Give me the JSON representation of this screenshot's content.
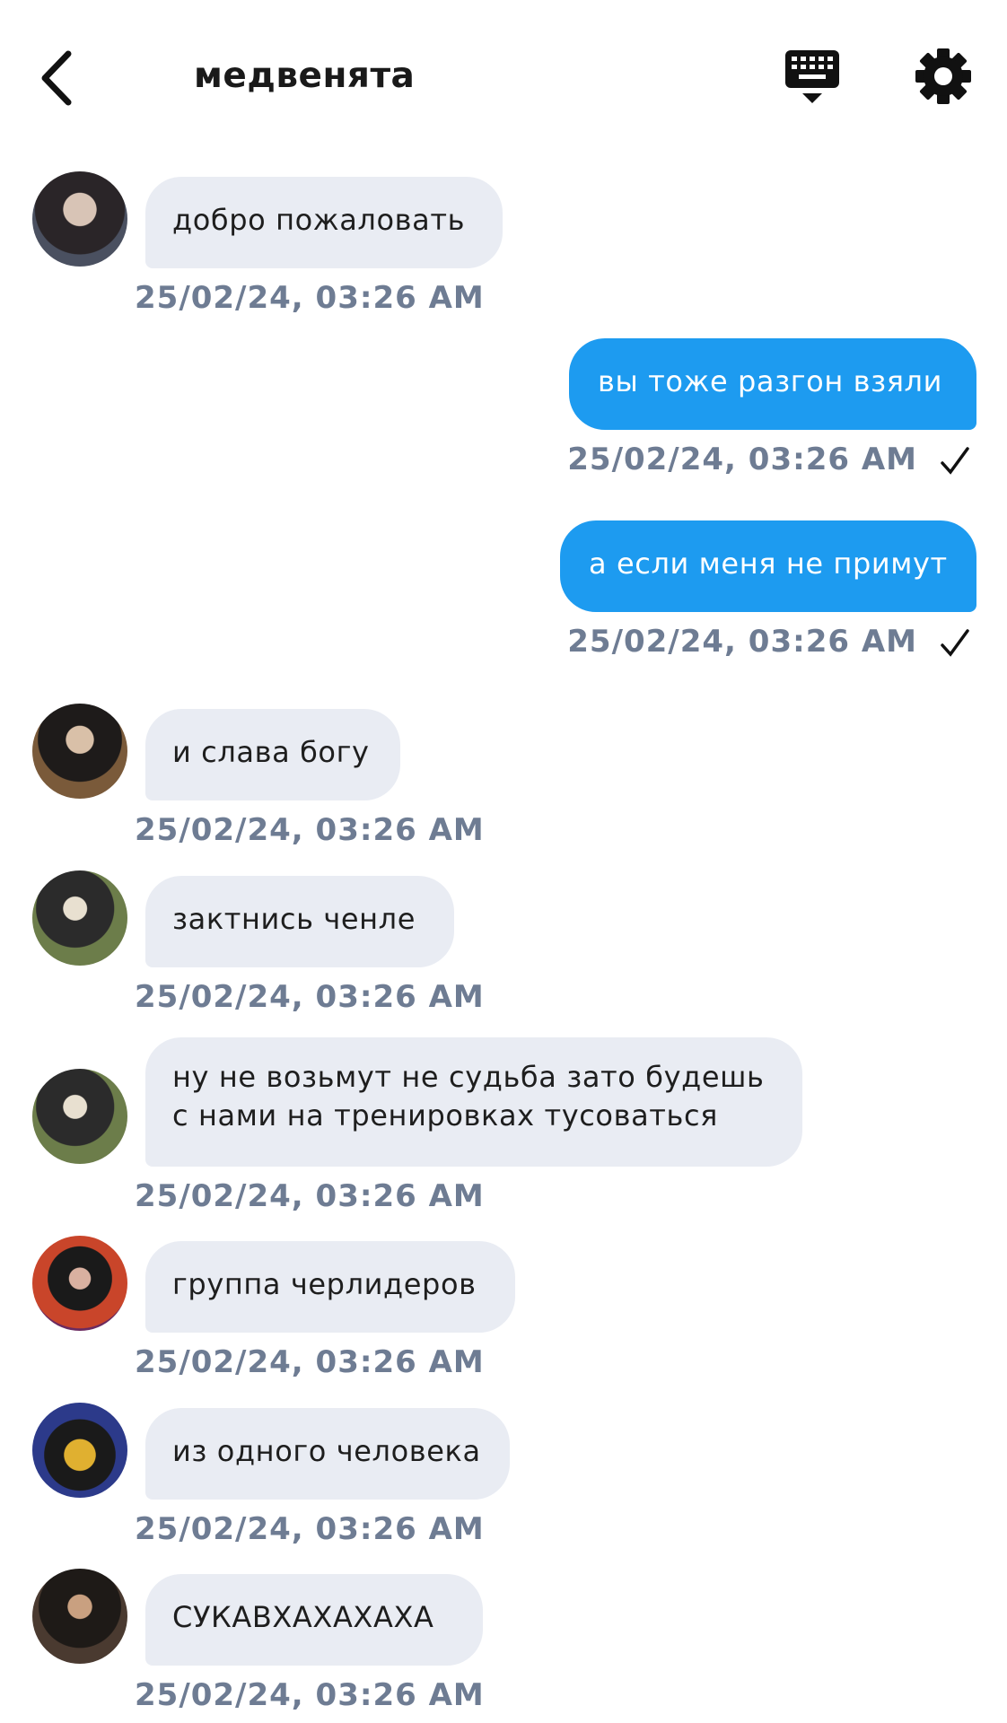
{
  "header": {
    "title": "медвенята",
    "back_icon": "chevron-left-icon",
    "keyboard_icon": "keyboard-hide-icon",
    "settings_icon": "gear-icon"
  },
  "colors": {
    "outgoing_bubble": "#1d9bf0",
    "incoming_bubble": "#e9ecf3",
    "timestamp": "#6e7c93"
  },
  "messages": [
    {
      "direction": "in",
      "text": "добро пожаловать",
      "time": "25/02/24, 03:26 AM"
    },
    {
      "direction": "out",
      "text": "вы тоже разгон взяли",
      "time": "25/02/24, 03:26 AM",
      "read": true
    },
    {
      "direction": "out",
      "text": "а если меня не примут",
      "time": "25/02/24, 03:26 AM",
      "read": true
    },
    {
      "direction": "in",
      "text": "и слава богу",
      "time": "25/02/24, 03:26 AM"
    },
    {
      "direction": "in",
      "text": "зактнись ченле",
      "time": "25/02/24, 03:26 AM"
    },
    {
      "direction": "in",
      "text_line1": "ну не возьмут не судьба зато будешь",
      "text_line2": "с нами на тренировках тусоваться",
      "time": "25/02/24, 03:26 AM"
    },
    {
      "direction": "in",
      "text": "группа черлидеров",
      "time": "25/02/24, 03:26 AM"
    },
    {
      "direction": "in",
      "text": "из одного человека",
      "time": "25/02/24, 03:26 AM"
    },
    {
      "direction": "in",
      "text": "СУКАВХАХАХАХА",
      "time": "25/02/24, 03:26 AM"
    }
  ]
}
